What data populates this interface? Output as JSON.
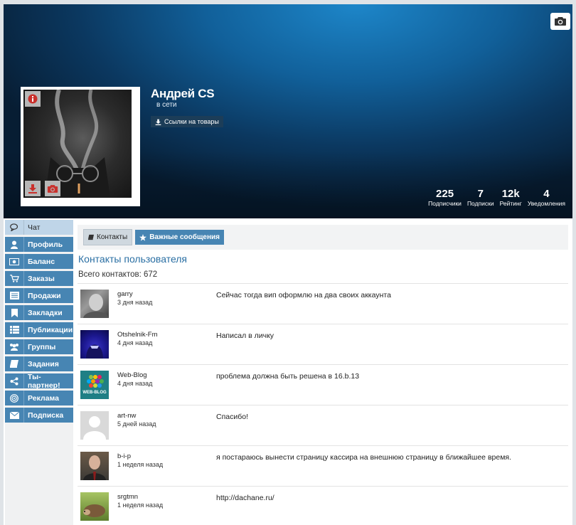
{
  "profile": {
    "name": "Андрей CS",
    "status": "в сети",
    "links_button": "Ссылки на товары"
  },
  "stats": [
    {
      "value": "225",
      "label": "Подписчики"
    },
    {
      "value": "7",
      "label": "Подписки"
    },
    {
      "value": "12k",
      "label": "Рейтинг"
    },
    {
      "value": "4",
      "label": "Уведомления"
    }
  ],
  "sidebar": {
    "items": [
      {
        "label": "Чат",
        "icon": "chat-icon"
      },
      {
        "label": "Профиль",
        "icon": "user-icon"
      },
      {
        "label": "Баланс",
        "icon": "money-icon"
      },
      {
        "label": "Заказы",
        "icon": "cart-icon"
      },
      {
        "label": "Продажи",
        "icon": "sales-icon"
      },
      {
        "label": "Закладки",
        "icon": "bookmark-icon"
      },
      {
        "label": "Публикации",
        "icon": "list-icon"
      },
      {
        "label": "Группы",
        "icon": "group-icon"
      },
      {
        "label": "Задания",
        "icon": "book-icon"
      },
      {
        "label": "Ты-партнер!",
        "icon": "share-icon"
      },
      {
        "label": "Реклама",
        "icon": "target-icon"
      },
      {
        "label": "Подписка",
        "icon": "envelope-icon"
      }
    ]
  },
  "tabs": {
    "contacts": "Контакты",
    "important": "Важные сообщения"
  },
  "main": {
    "title": "Контакты пользователя",
    "total": "Всего контактов: 672"
  },
  "contacts": [
    {
      "name": "garry",
      "time": "3 дня назад",
      "message": "Сейчас тогда вип оформлю на два своих аккаунта"
    },
    {
      "name": "Otshelnik-Fm",
      "time": "4 дня назад",
      "message": "Написал в личку"
    },
    {
      "name": "Web-Blog",
      "time": "4 дня назад",
      "message": "проблема должна быть решена в 16.b.13",
      "avatar_text": "WEB-BLOG"
    },
    {
      "name": "art-nw",
      "time": "5 дней назад",
      "message": "Спасибо!"
    },
    {
      "name": "b-i-p",
      "time": "1 неделя назад",
      "message": "я постараюсь вынести страницу кассира на внешнюю страницу в ближайшее время."
    },
    {
      "name": "srgtmn",
      "time": "1 неделя назад",
      "message": "http://dachane.ru/"
    }
  ],
  "colors": {
    "accent": "#4785b3",
    "title": "#2a6fa3",
    "dark_button": "#1c3d58",
    "danger_icon": "#c9302c"
  }
}
